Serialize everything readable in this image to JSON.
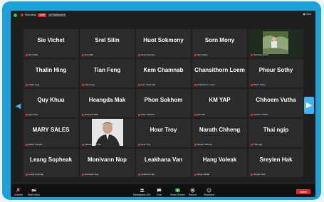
{
  "topbar": {
    "recording_label": "Recording",
    "live_badge": "LIVE",
    "live_destination": "on Facebook ▾",
    "view_label": "View"
  },
  "tiles": [
    {
      "name": "Sie Vichet",
      "label": "Sie Vichet"
    },
    {
      "name": "Srel Silin",
      "label": "Srel Silin"
    },
    {
      "name": "Huot Sokmony",
      "label": "Huot Sokmony"
    },
    {
      "name": "Sorn Mony",
      "label": "Sorn Mony"
    },
    {
      "name": "",
      "label": "Sambaty Pedrh",
      "video": "outdoor"
    },
    {
      "name": "Thalin Hing",
      "label": "Thalin Hing"
    },
    {
      "name": "Tian Feng",
      "label": "Tian Feng"
    },
    {
      "name": "Kem Chamnab",
      "label": "Kem Chamnab"
    },
    {
      "name": "Chansithorn Loem",
      "label": "Chansithorn Loem"
    },
    {
      "name": "Phour Sothy",
      "label": "Phour Sothy"
    },
    {
      "name": "Quy Khuu",
      "label": "Quy Khuu"
    },
    {
      "name": "Heangda Mak",
      "label": "Heangda Mak"
    },
    {
      "name": "Phon Sokhom",
      "label": "Phon Sokhom"
    },
    {
      "name": "KM YAP",
      "label": "KM YAP"
    },
    {
      "name": "Chhoem Vutha",
      "label": "Chhoem Vutha"
    },
    {
      "name": "MARY SALES",
      "label": "MARY SALES"
    },
    {
      "name": "",
      "label": "Jashan Janz Yeo",
      "video": "portrait"
    },
    {
      "name": "Hour Troy",
      "label": "Hour Troy"
    },
    {
      "name": "Narath Chheng",
      "label": "Narath Chheng"
    },
    {
      "name": "Thai ngip",
      "label": "Thai ngip"
    },
    {
      "name": "Leang Sopheak",
      "label": "Leang Sopheak"
    },
    {
      "name": "Monivann Nop",
      "label": "Monivann Nop"
    },
    {
      "name": "Leakhana Van",
      "label": "Leakhana Van"
    },
    {
      "name": "Hang Voleak",
      "label": "Hang Voleak"
    },
    {
      "name": "Sreylen Hak",
      "label": "Sreylen Hak"
    }
  ],
  "toolbar": {
    "unmute": "Unmute",
    "start_video": "Start Video",
    "participants": "Participants",
    "participants_count": "252",
    "chat": "Chat",
    "share_screen": "Share Screen",
    "record": "Record",
    "reactions": "Reactions",
    "end": "Leave"
  },
  "colors": {
    "frame": "#1aa3db",
    "accent": "#3db3f5",
    "end": "#e02828",
    "share": "#2ec13b"
  }
}
